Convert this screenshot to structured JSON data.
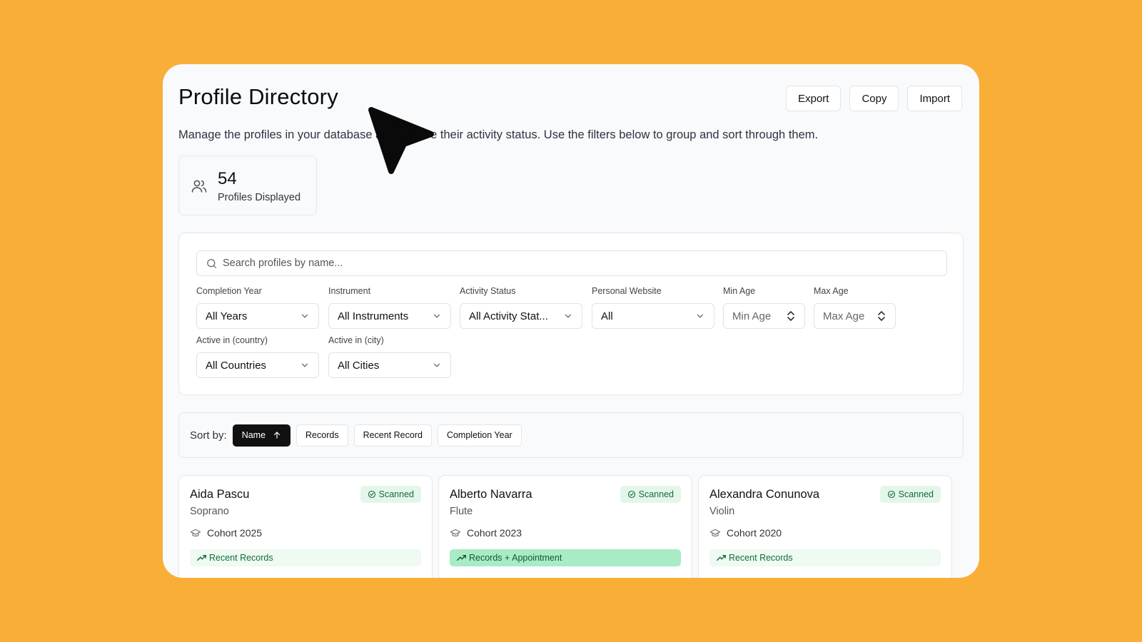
{
  "header": {
    "title": "Profile Directory",
    "description": "Manage the profiles in your database and explore their activity status. Use the filters below to group and sort through them.",
    "actions": [
      "Export",
      "Copy",
      "Import"
    ]
  },
  "stats": {
    "count": "54",
    "label": "Profiles Displayed"
  },
  "search": {
    "placeholder": "Search profiles by name..."
  },
  "filters": {
    "completion_year": {
      "label": "Completion Year",
      "value": "All Years"
    },
    "instrument": {
      "label": "Instrument",
      "value": "All Instruments"
    },
    "activity_status": {
      "label": "Activity Status",
      "value": "All Activity Stat..."
    },
    "personal_website": {
      "label": "Personal Website",
      "value": "All"
    },
    "min_age": {
      "label": "Min Age",
      "placeholder": "Min Age"
    },
    "max_age": {
      "label": "Max Age",
      "placeholder": "Max Age"
    },
    "country": {
      "label": "Active in (country)",
      "value": "All Countries"
    },
    "city": {
      "label": "Active in (city)",
      "value": "All Cities"
    }
  },
  "sort": {
    "label": "Sort by:",
    "options": [
      "Name",
      "Records",
      "Recent Record",
      "Completion Year"
    ],
    "active": "Name"
  },
  "profiles": [
    {
      "name": "Aida Pascu",
      "instrument": "Soprano",
      "status": "Scanned",
      "cohort": "Cohort 2025",
      "records": "Recent Records"
    },
    {
      "name": "Alberto Navarra",
      "instrument": "Flute",
      "status": "Scanned",
      "cohort": "Cohort 2023",
      "records": "Records + Appointment"
    },
    {
      "name": "Alexandra Conunova",
      "instrument": "Violin",
      "status": "Scanned",
      "cohort": "Cohort 2020",
      "records": "Recent Records"
    }
  ],
  "colors": {
    "background": "#F9AE38",
    "badge_bg": "#e4f6ea",
    "badge_text": "#146c3b",
    "records_strong_bg": "#a9ebc5"
  }
}
